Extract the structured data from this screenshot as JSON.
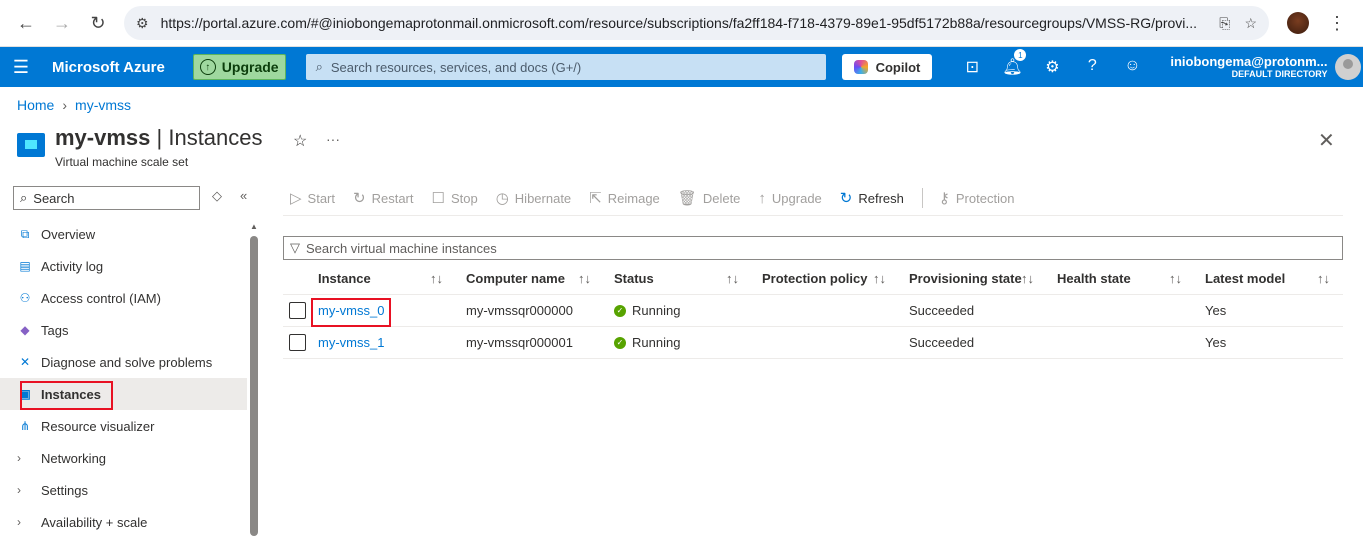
{
  "browser": {
    "url": "https://portal.azure.com/#@iniobongemaprotonmail.onmicrosoft.com/resource/subscriptions/fa2ff184-f718-4379-89e1-95df5172b88a/resourcegroups/VMSS-RG/provi..."
  },
  "topbar": {
    "brand": "Microsoft Azure",
    "upgrade": "Upgrade",
    "search_placeholder": "Search resources, services, and docs (G+/)",
    "copilot": "Copilot",
    "notification_count": "1",
    "user_name": "iniobongema@protonm...",
    "user_directory": "DEFAULT DIRECTORY"
  },
  "breadcrumb": {
    "home": "Home",
    "current": "my-vmss"
  },
  "header": {
    "resource": "my-vmss",
    "separator": " | ",
    "page": "Instances",
    "subtitle": "Virtual machine scale set"
  },
  "sidebar": {
    "search_placeholder": "Search",
    "items": [
      {
        "label": "Overview",
        "icon": "overview-icon"
      },
      {
        "label": "Activity log",
        "icon": "activity-log-icon"
      },
      {
        "label": "Access control (IAM)",
        "icon": "iam-icon"
      },
      {
        "label": "Tags",
        "icon": "tag-icon"
      },
      {
        "label": "Diagnose and solve problems",
        "icon": "wrench-icon"
      },
      {
        "label": "Instances",
        "icon": "instances-icon"
      },
      {
        "label": "Resource visualizer",
        "icon": "visualizer-icon"
      },
      {
        "label": "Networking",
        "icon": "chevron-right-icon"
      },
      {
        "label": "Settings",
        "icon": "chevron-right-icon"
      },
      {
        "label": "Availability + scale",
        "icon": "chevron-right-icon"
      }
    ]
  },
  "toolbar": {
    "start": "Start",
    "restart": "Restart",
    "stop": "Stop",
    "hibernate": "Hibernate",
    "reimage": "Reimage",
    "delete": "Delete",
    "upgrade": "Upgrade",
    "refresh": "Refresh",
    "protection": "Protection"
  },
  "instance_search_placeholder": "Search virtual machine instances",
  "table": {
    "columns": [
      "Instance",
      "Computer name",
      "Status",
      "Protection policy",
      "Provisioning state",
      "Health state",
      "Latest model"
    ],
    "rows": [
      {
        "instance": "my-vmss_0",
        "computer_name": "my-vmssqr000000",
        "status": "Running",
        "protection_policy": "",
        "provisioning_state": "Succeeded",
        "health_state": "",
        "latest_model": "Yes"
      },
      {
        "instance": "my-vmss_1",
        "computer_name": "my-vmssqr000001",
        "status": "Running",
        "protection_policy": "",
        "provisioning_state": "Succeeded",
        "health_state": "",
        "latest_model": "Yes"
      }
    ]
  }
}
